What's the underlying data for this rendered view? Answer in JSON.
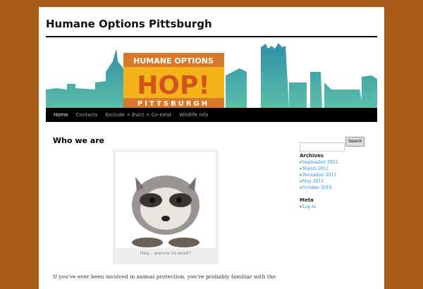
{
  "site": {
    "title": "Humane Options Pittsburgh"
  },
  "banner": {
    "top": "HUMANE OPTIONS",
    "logo": "HOP!",
    "bottom": "PITTSBURGH"
  },
  "nav": [
    "Home",
    "Contacts",
    "Exclude + Evict = Co-exist",
    "Wildlife info"
  ],
  "post": {
    "title": "Who we are",
    "caption": "Hey... wanna co-exist?",
    "text": "If you've ever been involved in animal protection, you're probably familiar with the"
  },
  "sidebar": {
    "search_button": "Search",
    "archives_title": "Archives",
    "archives": [
      "September 2012",
      "March 2012",
      "December 2011",
      "May 2011",
      "October 2010"
    ],
    "meta_title": "Meta",
    "meta": [
      "Log in"
    ]
  },
  "colors": {
    "background": "#a95a16",
    "skyline": "#4aaba6",
    "logo_orange": "#d9772a",
    "logo_yellow": "#f5b31a"
  }
}
